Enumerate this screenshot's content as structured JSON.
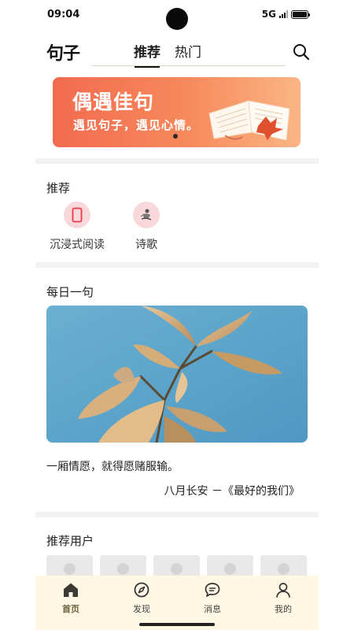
{
  "status": {
    "time": "09:04",
    "network": "5G"
  },
  "app": {
    "logo": "句子"
  },
  "tabs": [
    {
      "label": "推荐",
      "active": true
    },
    {
      "label": "热门",
      "active": false
    }
  ],
  "banner": {
    "title": "偶遇佳句",
    "subtitle": "遇见句子，遇见心情。",
    "colors": {
      "start": "#f26b4f",
      "end": "#fbb584"
    }
  },
  "recommend": {
    "title": "推荐",
    "items": [
      {
        "label": "沉浸式阅读",
        "icon": "phone-icon"
      },
      {
        "label": "诗歌",
        "icon": "poetry-icon"
      }
    ]
  },
  "daily": {
    "title": "每日一句",
    "quote": "一厢情愿，就得愿赌服输。",
    "author": "八月长安 －《最好的我们》"
  },
  "users": {
    "title": "推荐用户",
    "count_visible": 5
  },
  "bottom_nav": [
    {
      "label": "首页",
      "icon": "home-icon",
      "active": true
    },
    {
      "label": "发现",
      "icon": "compass-icon",
      "active": false
    },
    {
      "label": "消息",
      "icon": "message-icon",
      "active": false
    },
    {
      "label": "我的",
      "icon": "user-icon",
      "active": false
    }
  ],
  "colors": {
    "nav_bg": "#fdf7e3",
    "accent_pink": "#f9d8db",
    "sky": "#5aa3c9"
  }
}
